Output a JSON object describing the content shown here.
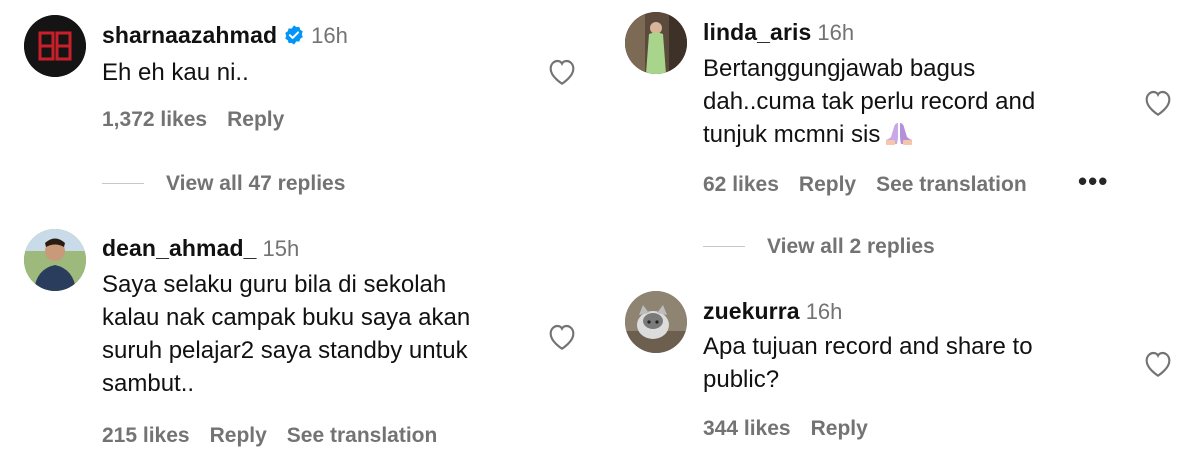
{
  "comments_left": [
    {
      "username": "sharnaazahmad",
      "verified": true,
      "time": "16h",
      "text": "Eh eh kau ni..",
      "likes": "1,372 likes",
      "reply": "Reply",
      "view_replies": "View all 47 replies"
    },
    {
      "username": "dean_ahmad_",
      "verified": false,
      "time": "15h",
      "text_lines": [
        "Saya selaku guru bila di sekolah",
        "kalau nak campak buku saya akan",
        "suruh pelajar2 saya standby untuk",
        "sambut.."
      ],
      "likes": "215 likes",
      "reply": "Reply",
      "translate": "See translation"
    }
  ],
  "comments_right": [
    {
      "username": "linda_aris",
      "verified": false,
      "time": "16h",
      "text_lines": [
        "Bertanggungjawab bagus",
        "dah..cuma tak perlu record and",
        "tunjuk mcmni sis"
      ],
      "emoji": "folded-hands-emoji",
      "likes": "62 likes",
      "reply": "Reply",
      "translate": "See translation",
      "more": "•••",
      "view_replies": "View all 2 replies"
    },
    {
      "username": "zuekurra",
      "verified": false,
      "time": "16h",
      "text_lines": [
        "Apa tujuan record and share to",
        "public?"
      ],
      "likes": "344 likes",
      "reply": "Reply"
    }
  ],
  "colors": {
    "secondary_text": "#737373",
    "verified_blue": "#0095f6"
  }
}
